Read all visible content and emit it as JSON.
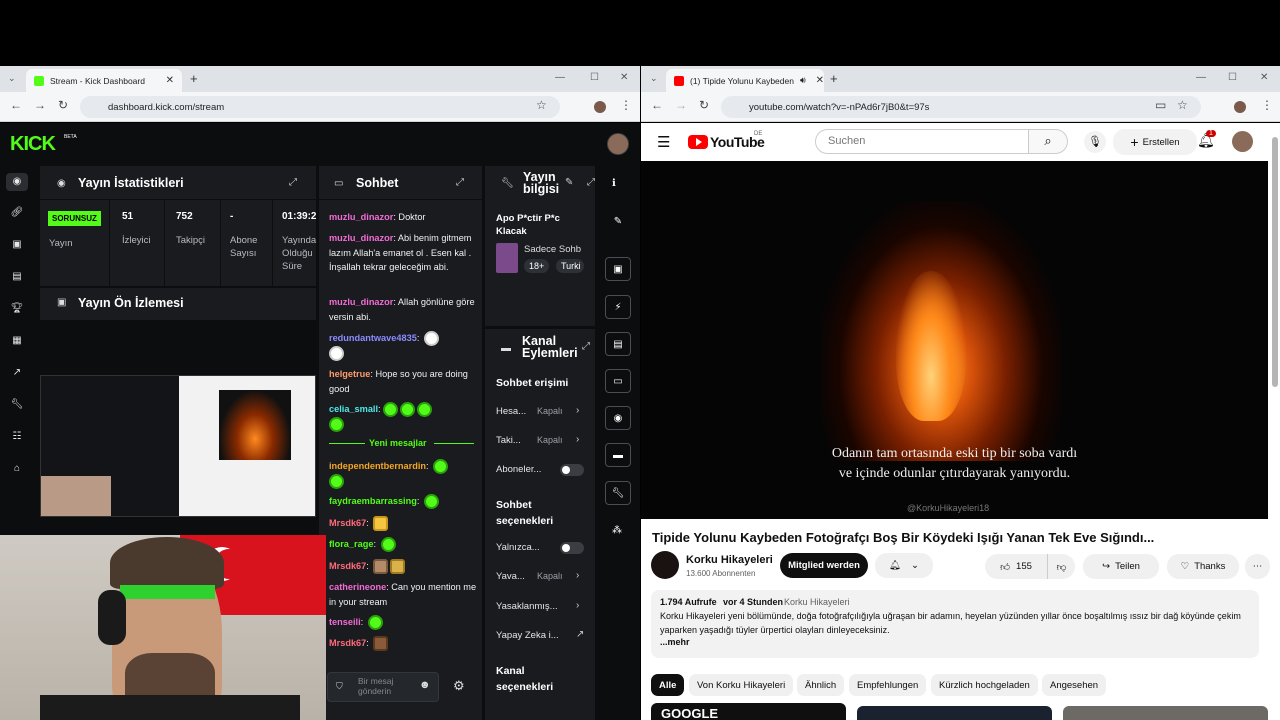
{
  "left_browser": {
    "tab_title": "Stream - Kick Dashboard",
    "url": "dashboard.kick.com/stream"
  },
  "kick": {
    "logo": "KICK",
    "logo_badge": "BETA",
    "stats_panel": {
      "title": "Yayın İstatistikleri",
      "status_badge": "SORUNSUZ",
      "status_label": "Yayın",
      "stats": [
        {
          "value": "51",
          "label": "İzleyici"
        },
        {
          "value": "752",
          "label": "Takipçi"
        },
        {
          "value": "-",
          "label": "Abone Sayısı"
        },
        {
          "value": "01:39:2",
          "label": "Yayında Olduğu Süre"
        }
      ]
    },
    "preview_panel": {
      "title": "Yayın Ön İzlemesi"
    },
    "chat_panel": {
      "title": "Sohbet",
      "messages": [
        {
          "user": "muzlu_dinazor",
          "color": "#f26bd4",
          "text": ": Doktor"
        },
        {
          "user": "muzlu_dinazor",
          "color": "#f26bd4",
          "text": ": Abi benim gitmem lazım Allah'a emanet ol . Esen kal . İnşallah tekrar geleceğim abi."
        },
        {
          "user": "muzlu_dinazor",
          "color": "#f26bd4",
          "text": ": Allah gönlüne göre versin abi."
        },
        {
          "user": "redundantwave4835",
          "color": "#8a8cff",
          "text": ":"
        },
        {
          "user": "helgetrue",
          "color": "#ff9b6b",
          "text": ": Hope so you are doing good"
        },
        {
          "user": "celia_small",
          "color": "#4fe8e8",
          "text": ":"
        }
      ],
      "new_messages": "Yeni mesajlar",
      "messages2": [
        {
          "user": "independentbernardin",
          "color": "#f5a623",
          "text": ":"
        },
        {
          "user": "faydraembarrassing",
          "color": "#53fc18",
          "text": ":"
        },
        {
          "user": "Mrsdk67",
          "color": "#ff6b7a",
          "text": ":"
        },
        {
          "user": "flora_rage",
          "color": "#53fc18",
          "text": ":"
        },
        {
          "user": "Mrsdk67",
          "color": "#ff6b7a",
          "text": ":"
        },
        {
          "user": "catherineone",
          "color": "#f26bd4",
          "text": ": Can you mention me in your stream"
        },
        {
          "user": "tenseili",
          "color": "#f26bd4",
          "text": ":"
        },
        {
          "user": "Mrsdk67",
          "color": "#ff6b7a",
          "text": ":"
        }
      ],
      "input_placeholder": "Bir mesaj gönderin"
    },
    "info_panel": {
      "title": "Yayın bilgisi",
      "stream_title": "Apo P*ctir P*c Klacak",
      "category": "Sadece Sohb",
      "tag_age": "18+",
      "tag_lang": "Turki"
    },
    "actions_panel": {
      "title": "Kanal Eylemleri",
      "section1": "Sohbet erişimi",
      "rows1": [
        {
          "label": "Hesa...",
          "value": "Kapalı"
        },
        {
          "label": "Taki...",
          "value": "Kapalı"
        },
        {
          "label": "Aboneler...",
          "value": ""
        }
      ],
      "section2": "Sohbet seçenekleri",
      "rows2": [
        {
          "label": "Yalnızca...",
          "value": ""
        },
        {
          "label": "Yava...",
          "value": "Kapalı"
        },
        {
          "label": "Yasaklanmış...",
          "value": ""
        },
        {
          "label": "Yapay Zeka i...",
          "value": ""
        }
      ],
      "section3": "Kanal seçenekleri"
    }
  },
  "right_browser": {
    "tab_title": "(1) Tipide Yolunu Kaybeden",
    "url": "youtube.com/watch?v=-nPAd6r7jB0&t=97s"
  },
  "youtube": {
    "logo": "YouTube",
    "logo_region": "DE",
    "search_placeholder": "Suchen",
    "create_label": "Erstellen",
    "notif_count": "1",
    "subtitle_line1": "Odanın tam ortasında eski tip bir soba vardı",
    "subtitle_line2": "ve içinde odunlar çıtırdayarak yanıyordu.",
    "watermark": "@KorkuHikayeleri18",
    "video_title": "Tipide Yolunu Kaybeden Fotoğrafçı Boş Bir Köydeki Işığı Yanan Tek Eve Sığındı...",
    "channel_name": "Korku Hikayeleri",
    "subscribers": "13.600 Abonnenten",
    "join_label": "Mitglied werden",
    "likes": "155",
    "share_label": "Teilen",
    "thanks_label": "Thanks",
    "views": "1.794 Aufrufe",
    "age": "vor 4 Stunden",
    "desc_channel": "Korku Hikayeleri",
    "description": "Korku Hikayeleri yeni bölümünde, doğa fotoğrafçılığıyla uğraşan bir adamın, heyelan yüzünden yıllar önce boşaltılmış ıssız bir dağ köyünde çekim yaparken yaşadığı tüyler ürpertici olayları dinleyeceksiniz.",
    "more": "...mehr",
    "chips": [
      "Alle",
      "Von Korku Hikayeleri",
      "Ähnlich",
      "Empfehlungen",
      "Kürzlich hochgeladen",
      "Angesehen"
    ],
    "thumb_label": "GOOGLE"
  },
  "colors": {
    "kick_green": "#53fc18",
    "yt_red": "#ff0000"
  }
}
